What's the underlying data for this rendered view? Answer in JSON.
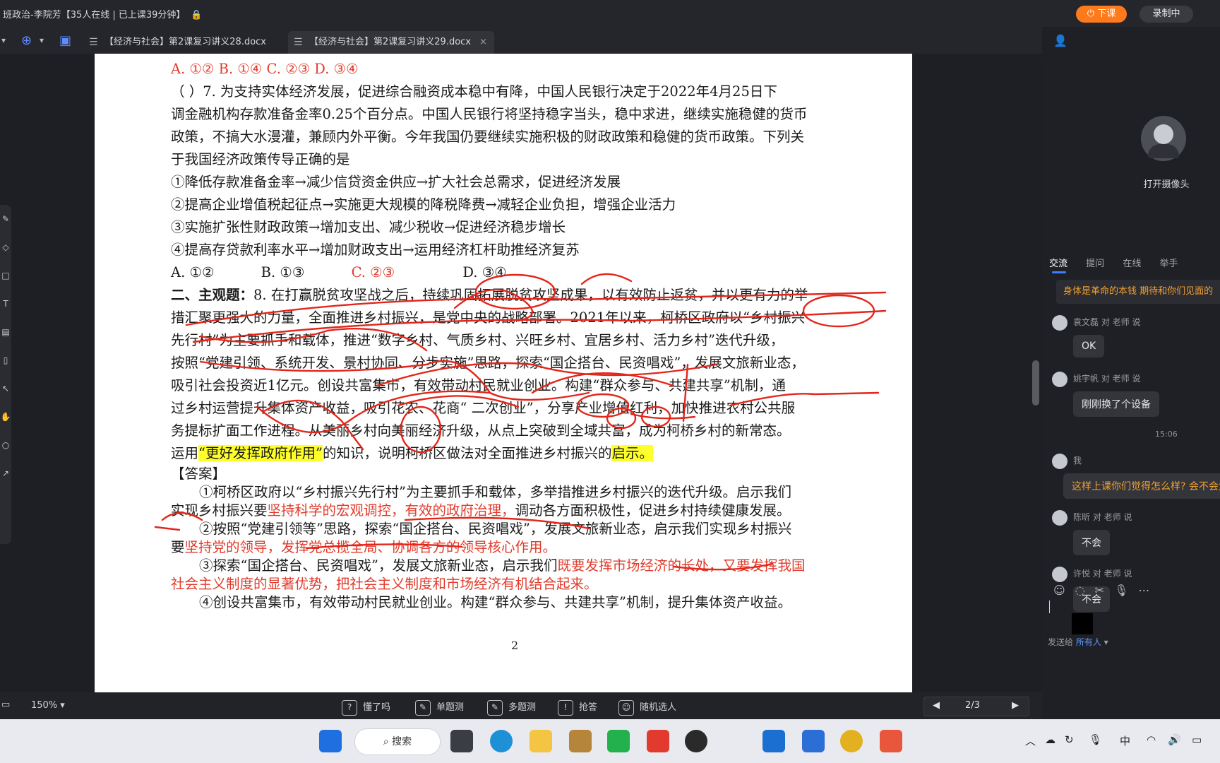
{
  "titlebar": {
    "title": "班政治-李院芳【35人在线 | 已上课39分钟】",
    "end_button": "下课",
    "record_button": "录制中"
  },
  "tabs": [
    {
      "label": "【经济与社会】第2课复习讲义28.docx"
    },
    {
      "label": "【经济与社会】第2课复习讲义29.docx"
    }
  ],
  "tab_close": "×",
  "document": {
    "lines": [
      {
        "text": "A. ①②    B. ①④    C. ②③    D. ③④"
      },
      {
        "text": "（    ）7. 为支持实体经济发展，促进综合融资成本稳中有降，中国人民银行决定于2022年4月25日下"
      },
      {
        "text": "调金融机构存款准备金率0.25个百分点。中国人民银行将坚持稳字当头，稳中求进，继续实施稳健的货币"
      },
      {
        "text": "政策，不搞大水漫灌，兼顾内外平衡。今年我国仍要继续实施积极的财政政策和稳健的货币政策。下列关"
      },
      {
        "text": "于我国经济政策传导正确的是"
      },
      {
        "text": "①降低存款准备金率→减少信贷资金供应→扩大社会总需求，促进经济发展"
      },
      {
        "text": "②提高企业增值税起征点→实施更大规模的降税降费→减轻企业负担，增强企业活力"
      },
      {
        "text": "③实施扩张性财政政策→增加支出、减少税收→促进经济稳步增长"
      },
      {
        "text": "④提高存贷款利率水平→增加财政支出→运用经济杠杆助推经济复苏"
      }
    ],
    "options2": {
      "a": "A. ①②",
      "b": "B. ①③",
      "c": "C. ②③",
      "d": "D. ③④"
    },
    "q8_head": "二、主观题：",
    "q8_lines": [
      "8. 在打赢脱贫攻坚战之后，持续巩固拓展脱贫攻坚成果，以有效防止返贫，并以更有力的举",
      "措汇聚更强大的力量，全面推进乡村振兴，是党中央的战略部署。2021年以来，柯桥区政府以“乡村振兴",
      "先行村”为主要抓手和载体，推进“数字乡村、气质乡村、兴旺乡村、宜居乡村、活力乡村”迭代升级，",
      "按照“党建引领、系统开发、景村协同、分步实施”思路，探索“国企搭台、民资唱戏”，发展文旅新业态，",
      "吸引社会投资近1亿元。创设共富集市，有效带动村民就业创业。构建“群众参与、共建共享”机制，通",
      "过乡村运营提升集体资产收益，吸引花农、花商“ 二次创业”，分享产业增值红利，加快推进农村公共服",
      "务提标扩面工作进程。从美丽乡村向美丽经济升级，从点上突破到全域共富，成为柯桥乡村的新常态。"
    ],
    "q8_ask": {
      "pre": "运用",
      "hl": "“更好发挥政府作用”",
      "mid": "的知识，说明柯桥区做法对全面推进乡村振兴的",
      "hl2": "启示。"
    },
    "answer_head": "【答案】",
    "ans1": {
      "t1": "①柯桥区政府以“乡村振兴先行村”为主要抓手和载体，多举措推进乡村振兴的迭代升级。启示我们",
      "t2": "实现乡村振兴要",
      "r1": "坚持科学的宏观调控，有效的政府治理，",
      "t3": "调动各方面积极性，促进乡村持续健康发展。"
    },
    "ans2": {
      "t1": "②按照“党建引领等”思路，探索“国企搭台、民资唱戏”，发展文旅新业态，启示我们实现乡村振兴",
      "t2": "要",
      "r1": "坚持党的领导，发挥党总揽全局、协调各方的领导核心作用。"
    },
    "ans3": {
      "t1": "③探索“国企搭台、民资唱戏”，发展文旅新业态，启示我们",
      "r1": "既要发挥市场经济的长处，又要发挥我国",
      "r2": "社会主义制度的显著优势，把社会主义制度和市场经济有机结合起来。"
    },
    "ans4": {
      "t1": "④创设共富集市，有效带动村民就业创业。构建“群众参与、共建共享”机制，提升集体资产收益。"
    },
    "page_number": "2"
  },
  "panel": {
    "camera_label": "打开摄像头",
    "tabs": [
      "交流",
      "提问",
      "在线",
      "举手"
    ],
    "pinned": "身体是革命的本钱 期待和你们见面的",
    "messages": [
      {
        "who": "袁文磊 对 老师 说",
        "text": "OK"
      },
      {
        "who": "姚宇帆 对 老师 说",
        "text": "刚刚换了个设备"
      },
      {
        "who": "我",
        "text": "这样上课你们觉得怎么样? 会不会太"
      },
      {
        "who": "陈昕 对 老师 说",
        "text": "不会"
      },
      {
        "who": "许悦 对 老师 说",
        "text": "不会"
      }
    ],
    "time": "15:06",
    "send_to_label": "发送给",
    "send_to_value": "所有人"
  },
  "bottombar": {
    "zoom": "150%",
    "tools": [
      "懂了吗",
      "单题测",
      "多题测",
      "抢答",
      "随机选人"
    ],
    "page_indicator": "2/3"
  },
  "taskbar": {
    "search": "搜索",
    "ime": "中"
  }
}
